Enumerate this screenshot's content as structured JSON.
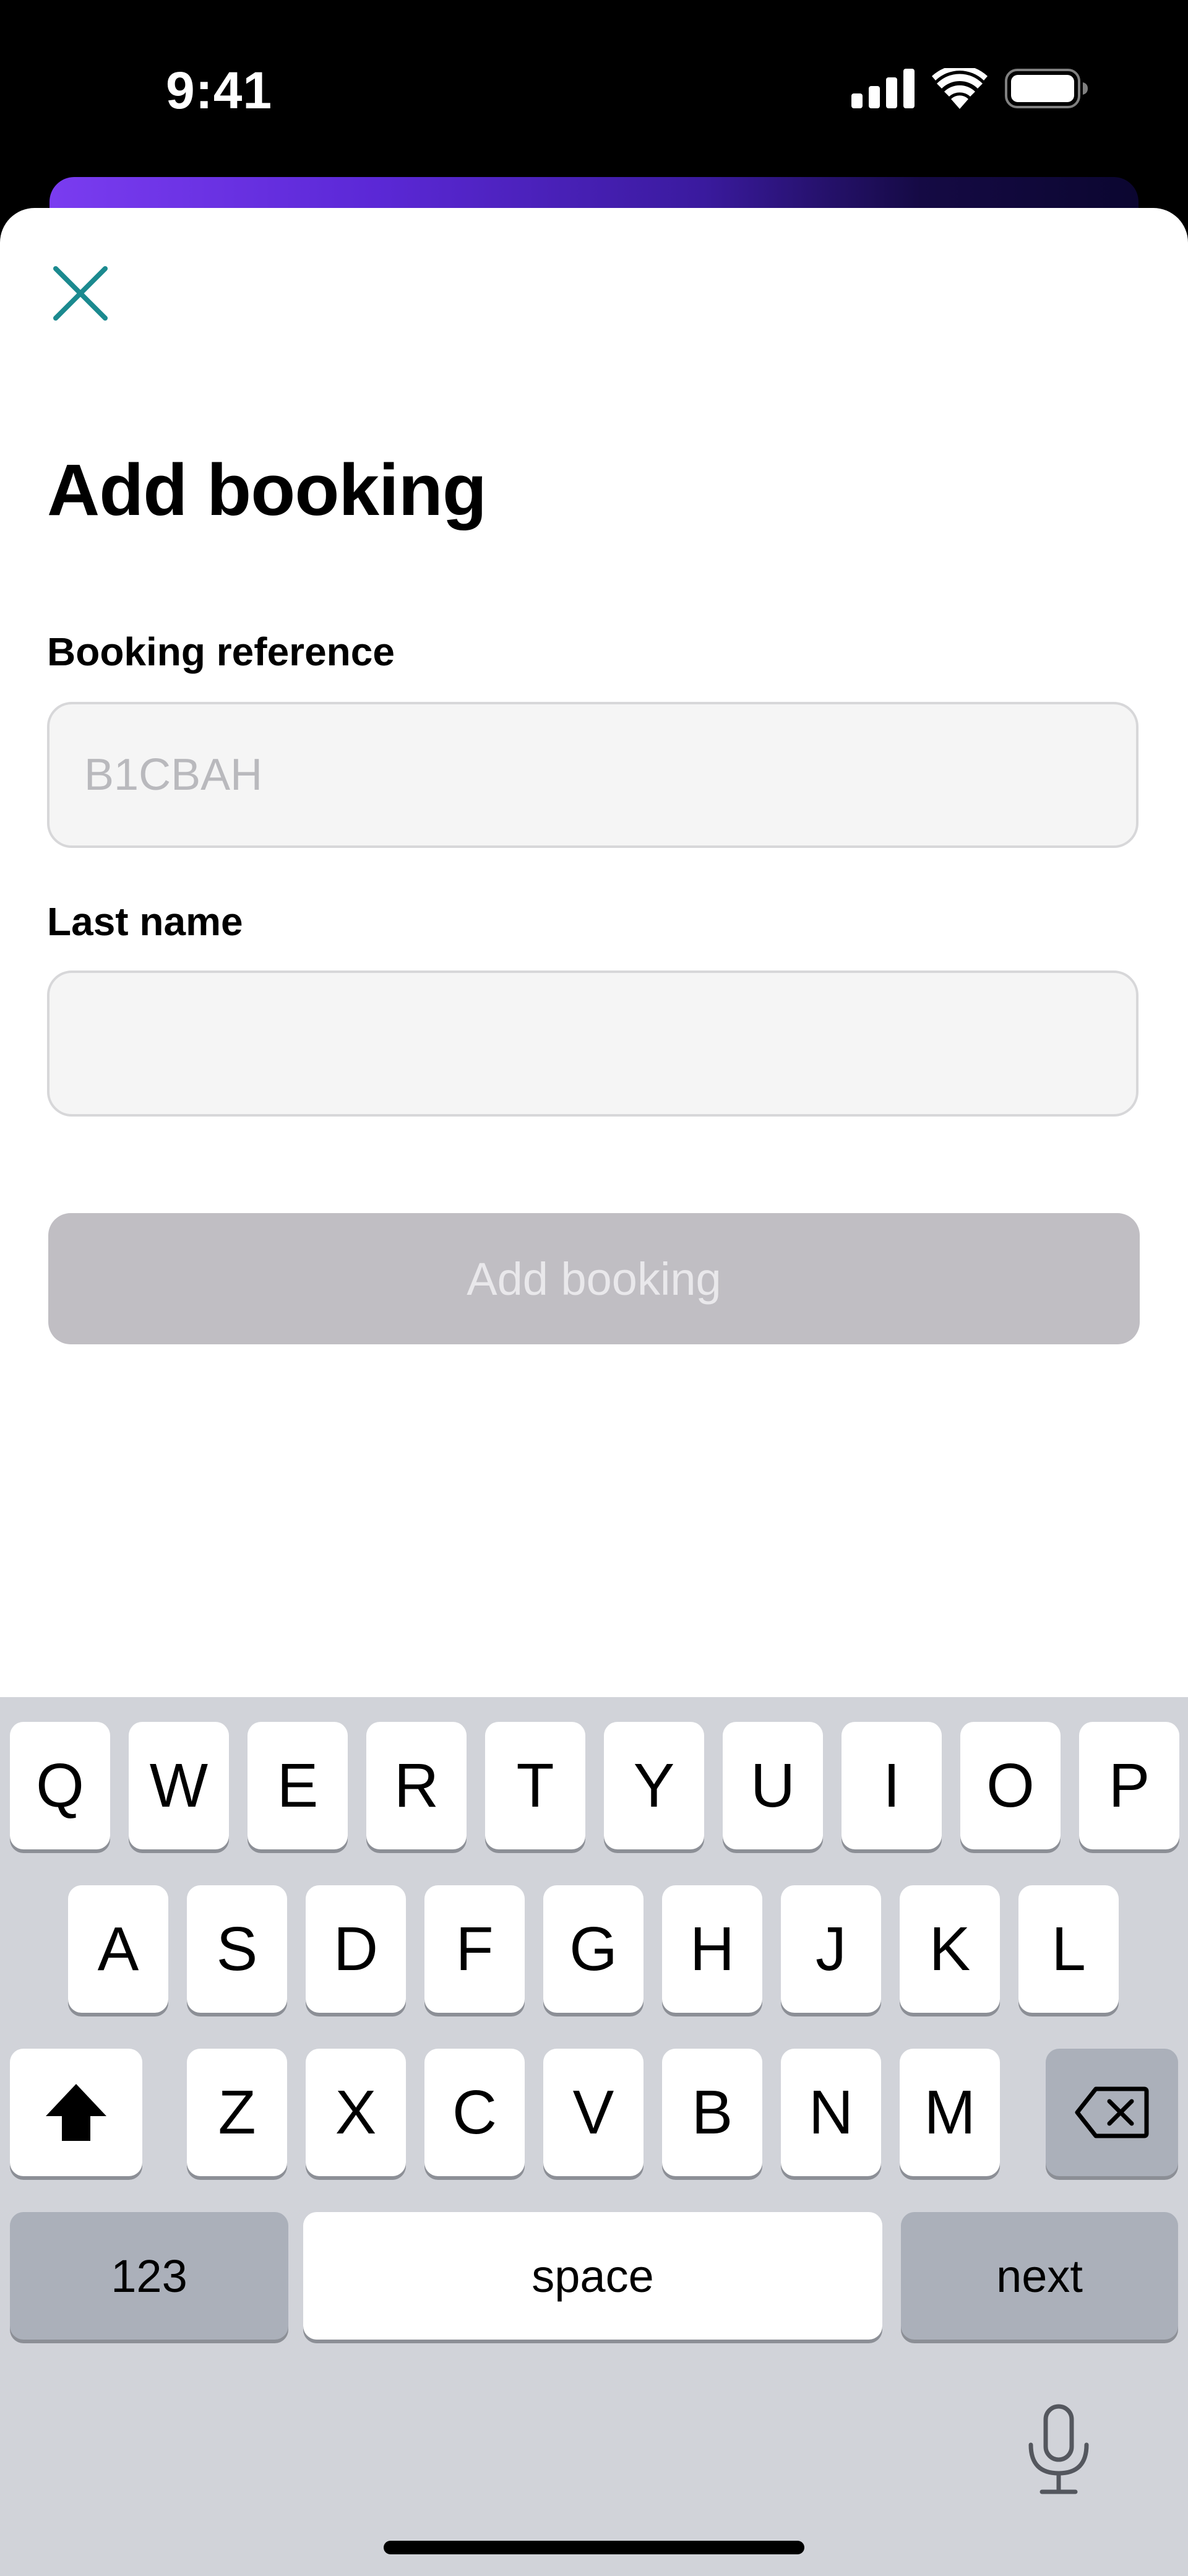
{
  "status_bar": {
    "time": "9:41",
    "icons": [
      "cellular-signal-icon",
      "wifi-icon",
      "battery-icon"
    ]
  },
  "header": {
    "close_icon": "close-icon",
    "title": "Add booking"
  },
  "form": {
    "booking_reference": {
      "label": "Booking reference",
      "placeholder": "B1CBAH",
      "value": ""
    },
    "last_name": {
      "label": "Last name",
      "placeholder": "",
      "value": ""
    },
    "submit_label": "Add booking"
  },
  "keyboard": {
    "row1": [
      "Q",
      "W",
      "E",
      "R",
      "T",
      "Y",
      "U",
      "I",
      "O",
      "P"
    ],
    "row2": [
      "A",
      "S",
      "D",
      "F",
      "G",
      "H",
      "J",
      "K",
      "L"
    ],
    "row3": [
      "Z",
      "X",
      "C",
      "V",
      "B",
      "N",
      "M"
    ],
    "shift_icon": "shift-icon",
    "backspace_icon": "backspace-icon",
    "numbers_label": "123",
    "space_label": "space",
    "next_label": "next",
    "mic_icon": "microphone-icon"
  },
  "colors": {
    "accent": "#1b8a8f",
    "banner_start": "#7a3cf0",
    "banner_end": "#0b0630",
    "button_disabled": "#c0bec3",
    "keyboard_bg": "#d1d3d9"
  }
}
